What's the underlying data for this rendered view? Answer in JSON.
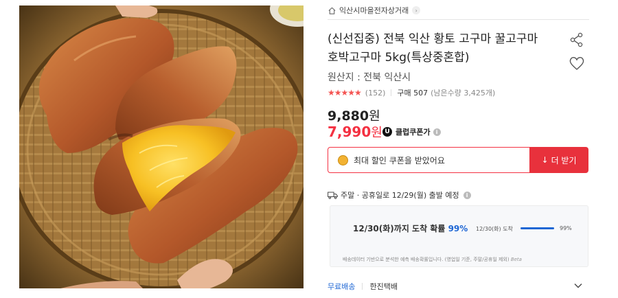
{
  "store": {
    "name": "익산시마을전자상거래",
    "chevron": "›",
    "icon": "home-icon"
  },
  "product": {
    "title_line1": "(신선집중) 전북 익산 황토 고구마 꿀고구마",
    "title_line2": "호박고구마 5kg(특상중혼합)",
    "origin": "원산지 : 전북 익산시",
    "image_alt_icon": "sweet-potato-photo"
  },
  "rating": {
    "stars": "★★★★★",
    "review_count": "(152)",
    "purchase": "구매 507",
    "remaining": "(남은수량 3,425개)",
    "star_color": "#f45452"
  },
  "price": {
    "original_value": "9,880",
    "sale_value": "7,990",
    "won": "원",
    "coupon_badge": "U",
    "coupon_label": "클럽쿠폰가",
    "info_glyph": "i",
    "sale_color": "#f43142"
  },
  "coupon": {
    "text": "최대 할인 쿠폰을 받았어요",
    "download_label": "더 받기",
    "download_arrow": "↓",
    "button_color": "#e8313c"
  },
  "shipping": {
    "text": "주말 · 공휴일로 12/29(월) 출발 예정",
    "info_glyph": "i"
  },
  "forecast": {
    "main_prefix": "12/30(화)까지 도착 확률",
    "main_pct": "99%",
    "bar_label": "12/30(화) 도착",
    "bar_value": 0.99,
    "bar_pct": "99%",
    "note": "배송데이터 기반으로 분석한 예측 배송확률입니다. (영업일 기준, 주말/공휴일 제외)",
    "beta": "Beta",
    "accent_color": "#1e66d4"
  },
  "delivery": {
    "free_label": "무료배송",
    "courier": "한진택배"
  }
}
